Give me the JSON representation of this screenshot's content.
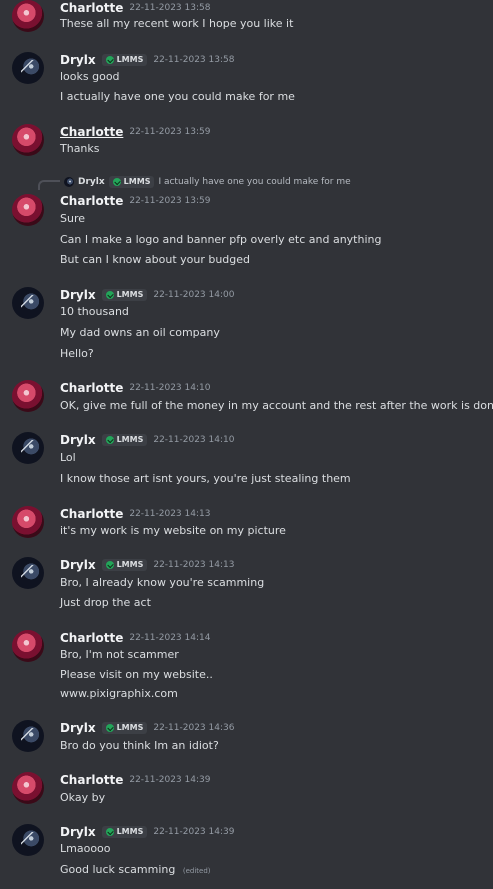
{
  "users": {
    "charlotte": {
      "name": "Charlotte"
    },
    "drylx": {
      "name": "Drylx",
      "tag": "LMMS"
    }
  },
  "messages": [
    {
      "time": "22-11-2023 13:58",
      "lines": [
        "These all my recent work I hope you like it"
      ]
    },
    {
      "time": "22-11-2023 13:58",
      "lines": [
        "looks good",
        "I actually have one you could make for me"
      ]
    },
    {
      "time": "22-11-2023 13:59",
      "lines": [
        "Thanks"
      ]
    },
    {
      "reply": {
        "name": "Drylx",
        "tag": "LMMS",
        "text": "I actually have one you could make for me"
      },
      "time": "22-11-2023 13:59",
      "lines": [
        "Sure",
        "Can I make a logo and banner pfp overly etc and anything",
        "But can I know about your budged"
      ]
    },
    {
      "time": "22-11-2023 14:00",
      "lines": [
        "10 thousand",
        "My dad owns an oil company",
        "Hello?"
      ]
    },
    {
      "time": "22-11-2023 14:10",
      "lines": [
        "OK, give me full of the money in my account and the rest after the work is done"
      ]
    },
    {
      "time": "22-11-2023 14:10",
      "lines": [
        "Lol",
        "I know those art isnt yours, you're just stealing them"
      ]
    },
    {
      "time": "22-11-2023 14:13",
      "lines": [
        "it's my work is my website on my picture"
      ]
    },
    {
      "time": "22-11-2023 14:13",
      "lines": [
        "Bro, I already know you're scamming",
        "Just drop the act"
      ]
    },
    {
      "time": "22-11-2023 14:14",
      "lines": [
        "Bro, I'm not  scammer",
        "Please visit on my website..",
        "www.pixigraphix.com"
      ]
    },
    {
      "time": "22-11-2023 14:36",
      "lines": [
        "Bro do you think Im an idiot?"
      ]
    },
    {
      "time": "22-11-2023 14:39",
      "lines": [
        "Okay by"
      ]
    },
    {
      "time": "22-11-2023 14:39",
      "lines": [
        "Lmaoooo",
        "Good luck scamming"
      ],
      "edited_label": "(edited)"
    }
  ]
}
